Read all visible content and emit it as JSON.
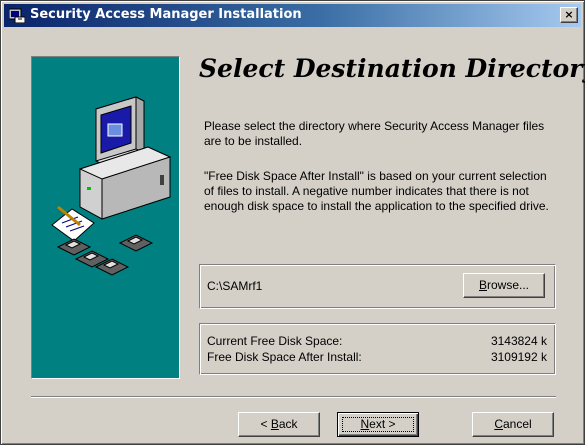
{
  "window": {
    "title": "Security Access Manager Installation",
    "close_glyph": "×"
  },
  "page": {
    "heading": "Select Destination Directory",
    "instructions": "Please select the directory where Security Access Manager files are to be installed.",
    "note": "\"Free Disk Space After Install\" is based on your current selection of files to install.  A negative number indicates that there is not enough disk space to install the application to the specified drive."
  },
  "destination": {
    "path": "C:\\SAMrf1",
    "browse_prefix": "B",
    "browse_rest": "rowse..."
  },
  "disk_space": {
    "current_label": "Current Free Disk Space:",
    "current_value": "3143824 k",
    "after_label": "Free Disk Space After Install:",
    "after_value": "3109192 k"
  },
  "buttons": {
    "back_prefix": "< ",
    "back_key": "B",
    "back_rest": "ack",
    "next_key": "N",
    "next_rest": "ext >",
    "cancel_key": "C",
    "cancel_rest": "ancel"
  },
  "colors": {
    "face": "#d4d0c8",
    "title_start": "#0a246a",
    "title_end": "#a6caf0",
    "sidebar": "#008080"
  },
  "icons": [
    "installer-app-icon",
    "close-icon",
    "computer-with-disks-icon"
  ]
}
